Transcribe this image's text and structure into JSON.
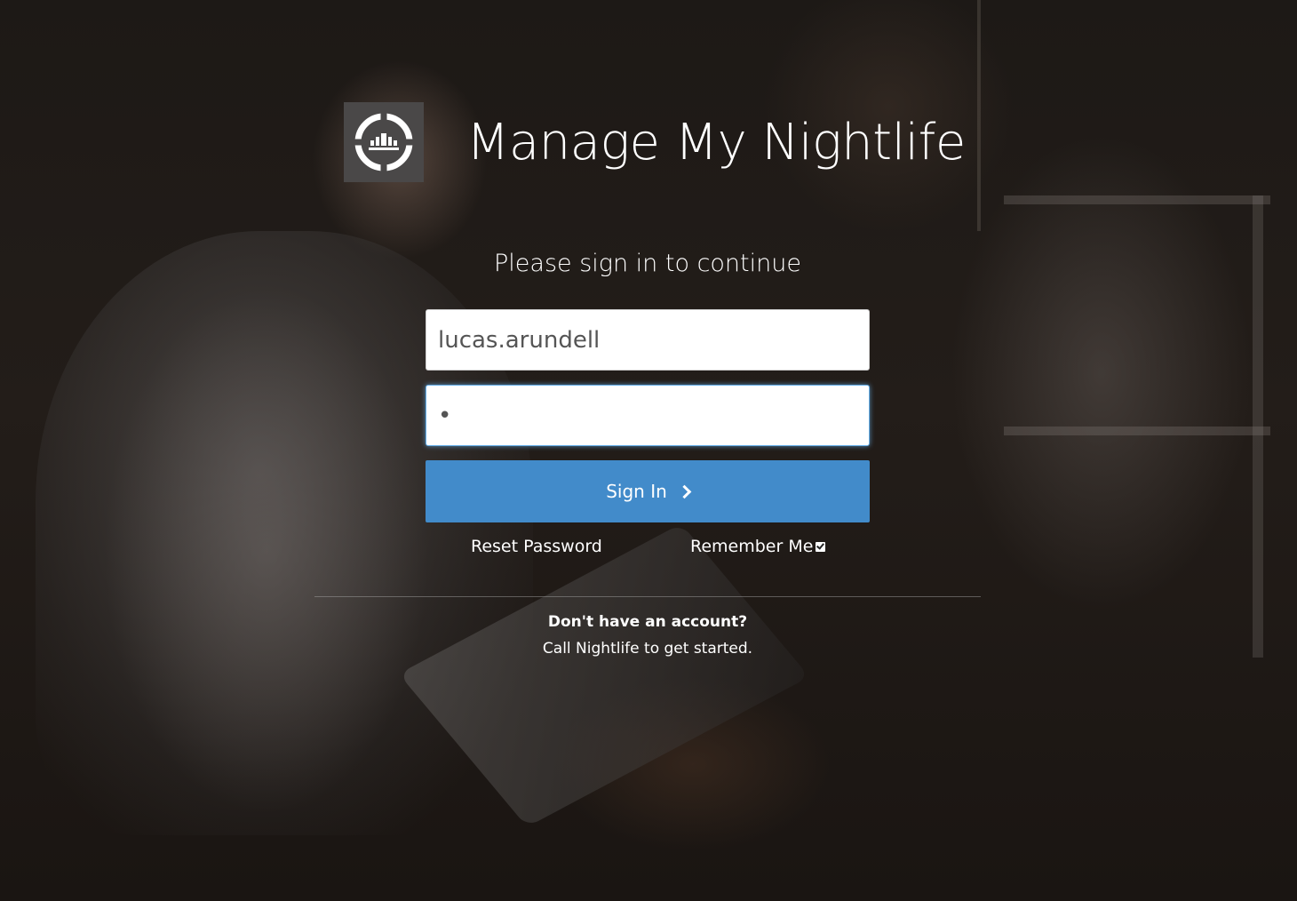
{
  "app": {
    "title": "Manage My Nightlife",
    "logo_icon": "nightlife-logo-icon"
  },
  "login": {
    "subtitle": "Please sign in to continue",
    "username_value": "lucas.arundell",
    "password_value": "•",
    "signin_label": "Sign In",
    "reset_label": "Reset Password",
    "remember_label": "Remember Me",
    "remember_checked": true
  },
  "footer": {
    "no_account": "Don't have an account?",
    "call_text": "Call Nightlife to get started."
  },
  "colors": {
    "primary_button": "#428bca",
    "logo_box": "#4a4848",
    "focus_border": "#66afe9"
  }
}
